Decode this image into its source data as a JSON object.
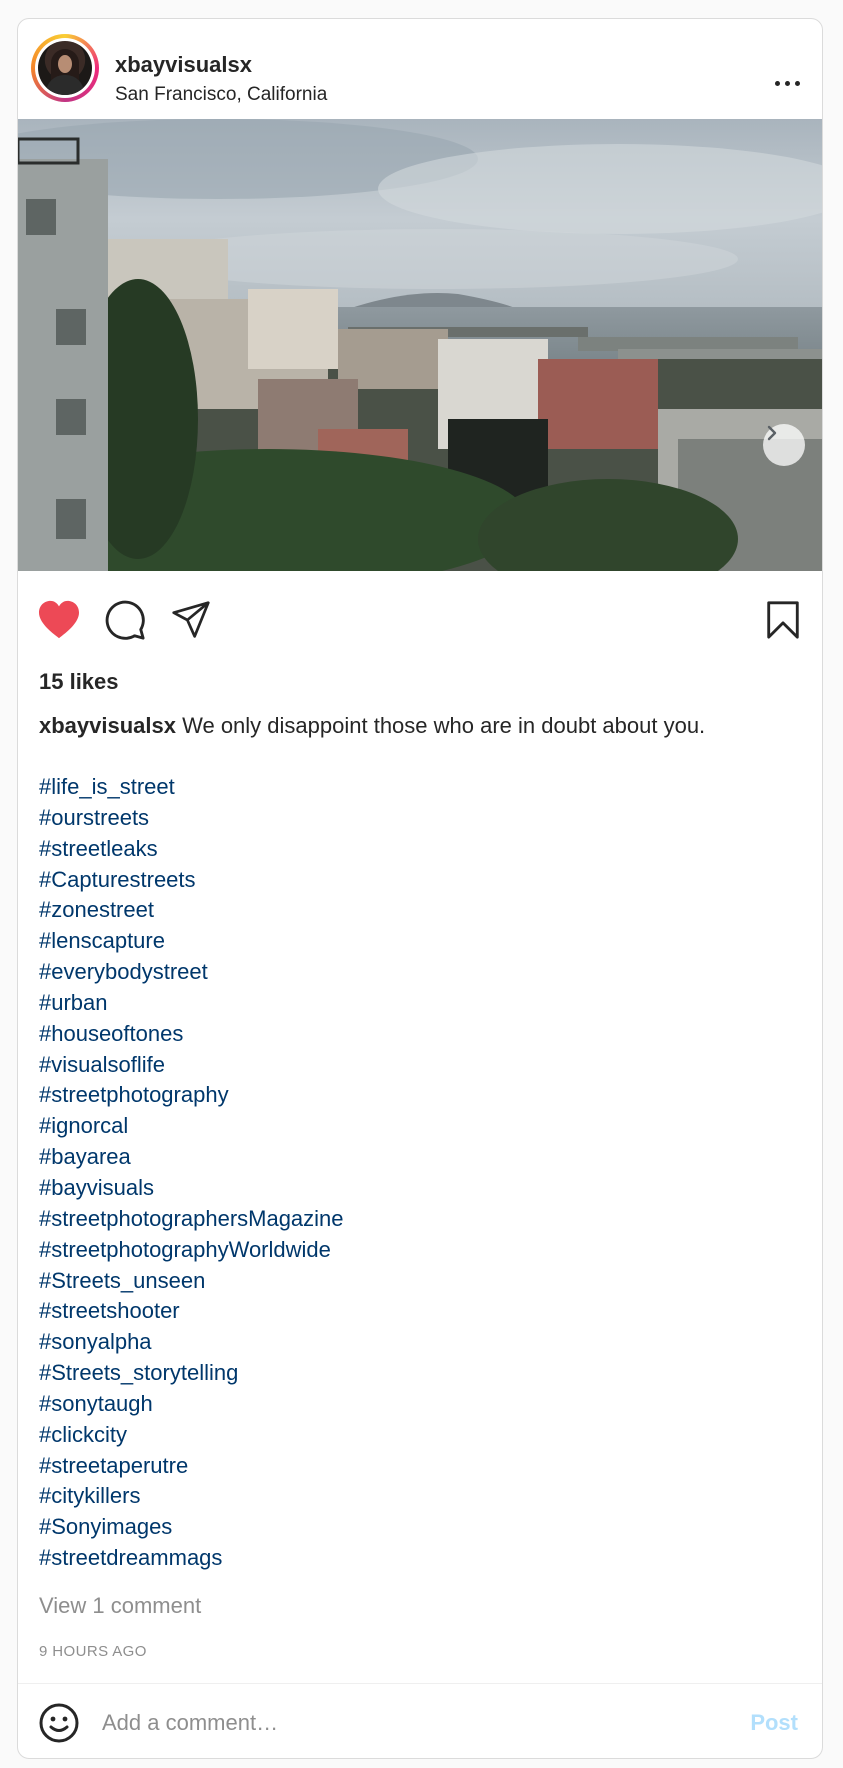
{
  "post": {
    "username": "xbayvisualsx",
    "location": "San Francisco, California",
    "image_alt": "",
    "carousel": {
      "total": 2,
      "current": 1
    },
    "likes_text": "15 likes",
    "liked": true,
    "caption_user": "xbayvisualsx",
    "caption_text": "We only disappoint those who are in doubt about you.",
    "hashtags": [
      "#life_is_street",
      "#ourstreets",
      "#streetleaks",
      "#Capturestreets",
      "#zonestreet",
      "#lenscapture",
      "#everybodystreet",
      "#urban",
      "#houseoftones",
      "#visualsoflife",
      "#streetphotography",
      "#ignorcal",
      "#bayarea",
      "#bayvisuals",
      "#streetphotographersMagazine",
      "#streetphotographyWorldwide",
      "#Streets_unseen",
      "#streetshooter",
      "#sonyalpha",
      "#Streets_storytelling",
      "#sonytaugh",
      "#clickcity",
      "#streetaperutre",
      "#citykillers",
      "#Sonyimages",
      "#streetdreammags"
    ],
    "view_comments": "View 1 comment",
    "timestamp": "9 HOURS AGO"
  },
  "comment_box": {
    "placeholder": "Add a comment…",
    "post_label": "Post"
  },
  "icons": {
    "like": "heart-icon",
    "comment": "comment-icon",
    "share": "paper-plane-icon",
    "save": "bookmark-icon",
    "more": "more-dots-icon",
    "next": "chevron-right-icon",
    "emoji": "smiley-icon"
  },
  "colors": {
    "like": "#ed4956",
    "hashtag": "#00376b",
    "muted": "#8e8e8e",
    "post_disabled": "#b2dffc",
    "text": "#262626"
  }
}
